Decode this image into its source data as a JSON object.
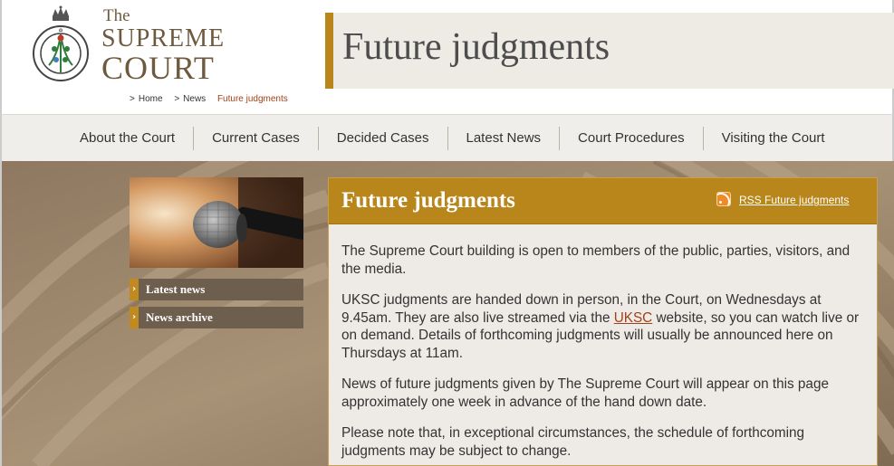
{
  "header": {
    "logo_the": "The",
    "logo_supreme": "SUPREME",
    "logo_court": "COURT",
    "logo_seal_text": "THE SUPREME COURT",
    "page_title": "Future judgments"
  },
  "breadcrumb": {
    "home": "Home",
    "news": "News",
    "current": "Future judgments"
  },
  "nav": {
    "items": [
      "About the Court",
      "Current Cases",
      "Decided Cases",
      "Latest News",
      "Court Procedures",
      "Visiting the Court"
    ]
  },
  "sidebar": {
    "latest_news": "Latest news",
    "news_archive": "News archive"
  },
  "panel": {
    "title": "Future judgments",
    "rss_label": "RSS Future judgments",
    "p1": "The Supreme Court building is open to members of the public, parties, visitors, and the media.",
    "p2_before": "UKSC judgments are handed down in person, in the Court, on Wednesdays at 9.45am. They are also live streamed via the ",
    "p2_link": "UKSC",
    "p2_after": " website, so you can watch live or on demand. Details of forthcoming judgments will usually be announced here on Thursdays at 11am.",
    "p3": "News of future judgments given by The Supreme Court will appear on this page approximately one week in advance of the hand down date.",
    "p4": "Please note that, in exceptional circumstances, the schedule of forthcoming judgments may be subject to change."
  },
  "colors": {
    "accent_gold": "#b8861b",
    "link": "#a0421b",
    "background_brown": "#a08a70"
  }
}
